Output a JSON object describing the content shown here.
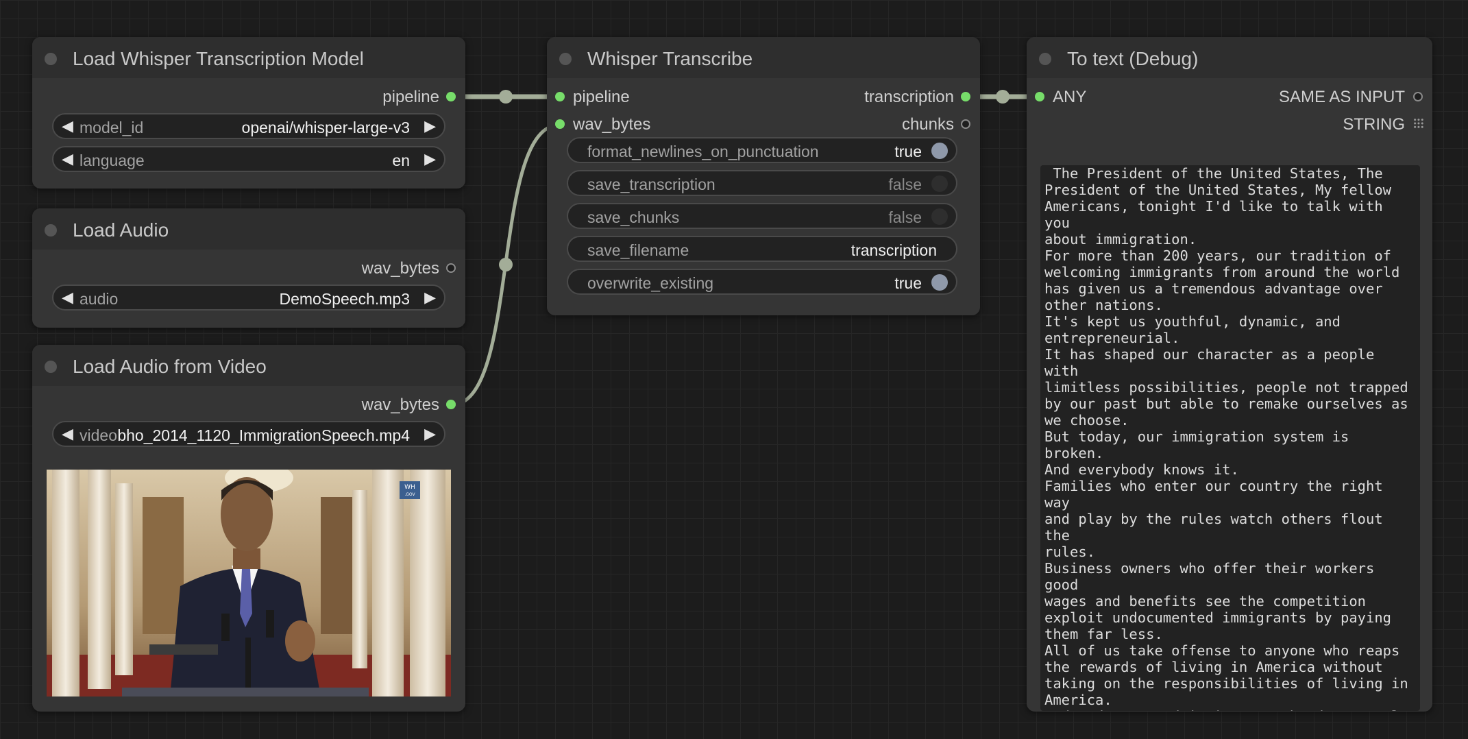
{
  "nodes": {
    "whisper_model": {
      "title": "Load Whisper Transcription Model",
      "output": "pipeline",
      "widgets": [
        {
          "name": "model_id",
          "value": "openai/whisper-large-v3"
        },
        {
          "name": "language",
          "value": "en"
        }
      ]
    },
    "load_audio": {
      "title": "Load Audio",
      "output": "wav_bytes",
      "widgets": [
        {
          "name": "audio",
          "value": "DemoSpeech.mp3"
        }
      ]
    },
    "load_audio_video": {
      "title": "Load Audio from Video",
      "output": "wav_bytes",
      "widgets": [
        {
          "name": "video",
          "value": "bho_2014_1120_ImmigrationSpeech.mp4"
        }
      ],
      "preview_badge": "WH .GOV"
    },
    "transcribe": {
      "title": "Whisper Transcribe",
      "inputs": [
        "pipeline",
        "wav_bytes"
      ],
      "outputs": [
        "transcription",
        "chunks"
      ],
      "widgets": [
        {
          "name": "format_newlines_on_punctuation",
          "value": "true"
        },
        {
          "name": "save_transcription",
          "value": "false"
        },
        {
          "name": "save_chunks",
          "value": "false"
        },
        {
          "name": "save_filename",
          "value": "transcription"
        },
        {
          "name": "overwrite_existing",
          "value": "true"
        }
      ]
    },
    "to_text": {
      "title": "To text (Debug)",
      "input": "ANY",
      "outputs": [
        "SAME AS INPUT",
        "STRING"
      ],
      "text": " The President of the United States, The\nPresident of the United States, My fellow\nAmericans, tonight I'd like to talk with you\nabout immigration.\nFor more than 200 years, our tradition of\nwelcoming immigrants from around the world\nhas given us a tremendous advantage over\nother nations.\nIt's kept us youthful, dynamic, and\nentrepreneurial.\nIt has shaped our character as a people with\nlimitless possibilities, people not trapped\nby our past but able to remake ourselves as\nwe choose.\nBut today, our immigration system is broken.\nAnd everybody knows it.\nFamilies who enter our country the right way\nand play by the rules watch others flout the\nrules.\nBusiness owners who offer their workers good\nwages and benefits see the competition\nexploit undocumented immigrants by paying\nthem far less.\nAll of us take offense to anyone who reaps\nthe rewards of living in America without\ntaking on the responsibilities of living in\nAmerica.\nAnd undocumented immigrants who desperately\nwant to embrace those responsibilities see\nlittle option but to remain in the shadows or\nrisk their families being torn apart.\nIt's been this way for decades.\nAnd for decades, we haven't done much about"
    }
  },
  "colors": {
    "connected_slot": "#77dd6a",
    "wire": "#a3ad98",
    "node_body": "#353535",
    "canvas": "#1c1c1c"
  }
}
